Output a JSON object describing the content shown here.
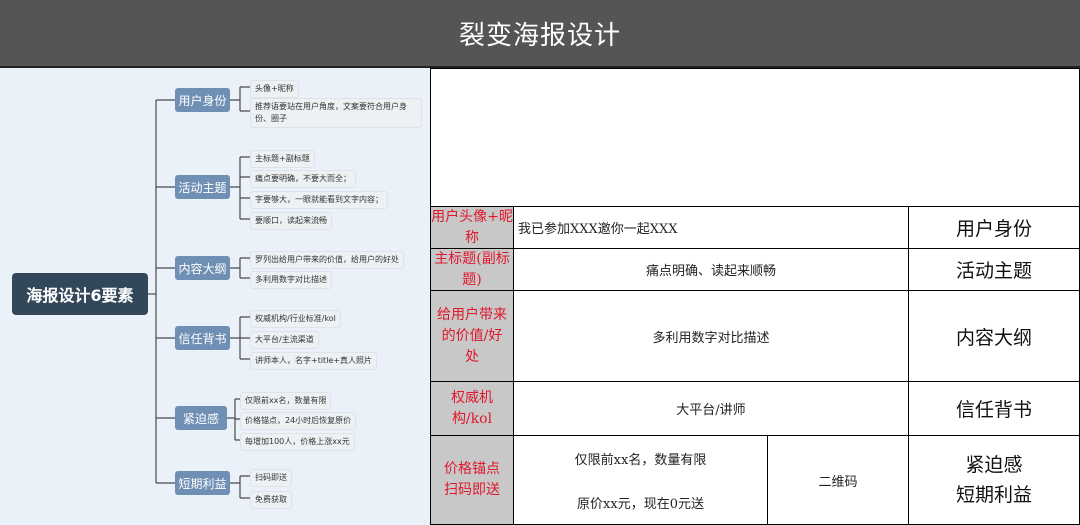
{
  "title": "裂变海报设计",
  "mindmap": {
    "root": "海报设计6要素",
    "branches": [
      {
        "label": "用户身份",
        "leaves": [
          "头像+昵称",
          "推荐语要站在用户角度，文案要符合用户身份、圈子"
        ]
      },
      {
        "label": "活动主题",
        "leaves": [
          "主标题+副标题",
          "痛点要明确，不要大而全；",
          "字要够大，一眼就能看到文字内容；",
          "要顺口，读起来流畅"
        ]
      },
      {
        "label": "内容大纲",
        "leaves": [
          "罗列出给用户带来的价值，给用户的好处",
          "多利用数字对比描述"
        ]
      },
      {
        "label": "信任背书",
        "leaves": [
          "权威机构/行业标准/kol",
          "大平台/主流渠道",
          "讲师本人，名字+title+真人照片"
        ]
      },
      {
        "label": "紧迫感",
        "leaves": [
          "仅限前xx名，数量有限",
          "价格锚点，24小时后恢复原价",
          "每增加100人，价格上涨xx元"
        ]
      },
      {
        "label": "短期利益",
        "leaves": [
          "扫码即送",
          "免费获取"
        ]
      }
    ]
  },
  "table": {
    "rows": [
      {
        "label": "用户头像+昵称",
        "content": "我已参加XXX邀你一起XXX",
        "category": "用户身份"
      },
      {
        "label": "主标题(副标题)",
        "content": "痛点明确、读起来顺畅",
        "category": "活动主题"
      },
      {
        "label": "给用户带来的价值/好处",
        "content": "多利用数字对比描述",
        "category": "内容大纲"
      },
      {
        "label": "权威机构/kol",
        "content": "大平台/讲师",
        "category": "信任背书"
      }
    ],
    "last_row": {
      "label_line1": "价格锚点",
      "label_line2": "扫码即送",
      "content_line1": "仅限前xx名，数量有限",
      "content_line2": "原价xx元，现在0元送",
      "qr": "二维码",
      "category_line1": "紧迫感",
      "category_line2": "短期利益"
    }
  }
}
